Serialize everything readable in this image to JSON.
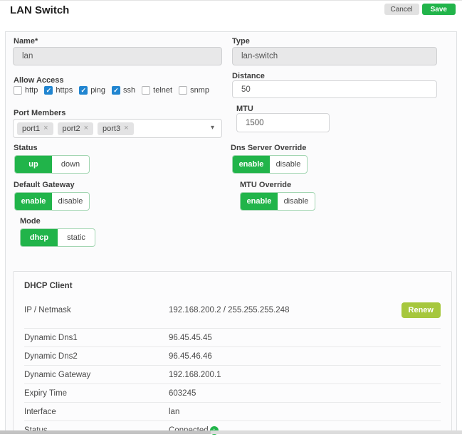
{
  "header": {
    "title": "LAN Switch",
    "cancel_label": "Cancel",
    "save_label": "Save"
  },
  "form": {
    "name": {
      "label": "Name*",
      "value": "lan"
    },
    "type": {
      "label": "Type",
      "value": "lan-switch"
    },
    "allow_access": {
      "label": "Allow Access",
      "options": [
        {
          "label": "http",
          "checked": false
        },
        {
          "label": "https",
          "checked": true
        },
        {
          "label": "ping",
          "checked": true
        },
        {
          "label": "ssh",
          "checked": true
        },
        {
          "label": "telnet",
          "checked": false
        },
        {
          "label": "snmp",
          "checked": false
        }
      ]
    },
    "distance": {
      "label": "Distance",
      "value": "50"
    },
    "port_members": {
      "label": "Port Members",
      "tags": [
        "port1",
        "port2",
        "port3"
      ]
    },
    "mtu": {
      "label": "MTU",
      "value": "1500"
    },
    "status": {
      "label": "Status",
      "on": "up",
      "off": "down",
      "selected": "up"
    },
    "dns_server_override": {
      "label": "Dns Server Override",
      "on": "enable",
      "off": "disable",
      "selected": "enable"
    },
    "default_gateway": {
      "label": "Default Gateway",
      "on": "enable",
      "off": "disable",
      "selected": "enable"
    },
    "mtu_override": {
      "label": "MTU Override",
      "on": "enable",
      "off": "disable",
      "selected": "enable"
    },
    "mode": {
      "label": "Mode",
      "on": "dhcp",
      "off": "static",
      "selected": "dhcp"
    }
  },
  "dhcp_client": {
    "title": "DHCP Client",
    "renew_label": "Renew",
    "rows": [
      {
        "label": "IP / Netmask",
        "value": "192.168.200.2 / 255.255.255.248"
      },
      {
        "label": "Dynamic Dns1",
        "value": "96.45.45.45"
      },
      {
        "label": "Dynamic Dns2",
        "value": "96.45.46.46"
      },
      {
        "label": "Dynamic Gateway",
        "value": "192.168.200.1"
      },
      {
        "label": "Expiry Time",
        "value": "603245"
      },
      {
        "label": "Interface",
        "value": "lan"
      },
      {
        "label": "Status",
        "value": "Connected",
        "status_icon": "up-arrow-circle"
      }
    ]
  },
  "icons": {
    "check": "✓",
    "remove": "×",
    "caret": "▾",
    "up_arrow": "↑"
  },
  "colors": {
    "green": "#21b44a",
    "lime": "#a6c73d",
    "checkbox_blue": "#2185d0",
    "disabled_bg": "#e8e8e9"
  }
}
